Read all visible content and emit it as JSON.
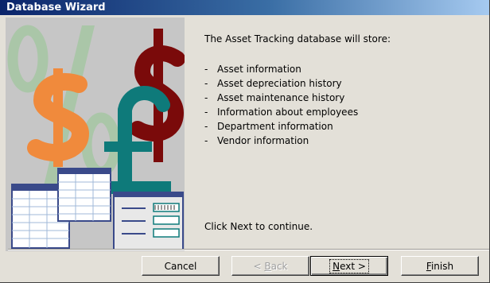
{
  "window": {
    "title": "Database Wizard"
  },
  "content": {
    "intro": "The Asset Tracking database will store:",
    "items": [
      "Asset information",
      "Asset depreciation history",
      "Asset maintenance history",
      "Information about employees",
      "Department information",
      "Vendor information"
    ],
    "bullet": "-",
    "continue_text": "Click Next to continue."
  },
  "buttons": {
    "cancel": "Cancel",
    "back_prefix": "< ",
    "back_mnemonic": "B",
    "back_rest": "ack",
    "next_mnemonic": "N",
    "next_rest": "ext >",
    "finish_mnemonic": "F",
    "finish_rest": "inish"
  },
  "colors": {
    "titlebar_start": "#0a246a",
    "titlebar_end": "#a6caf0",
    "dialog_bg": "#e3e0d8",
    "percent": "#aac6a8",
    "dollar_orange": "#f08a3c",
    "dollar_red": "#7a0a0a",
    "pound_teal": "#0e7a7a"
  }
}
